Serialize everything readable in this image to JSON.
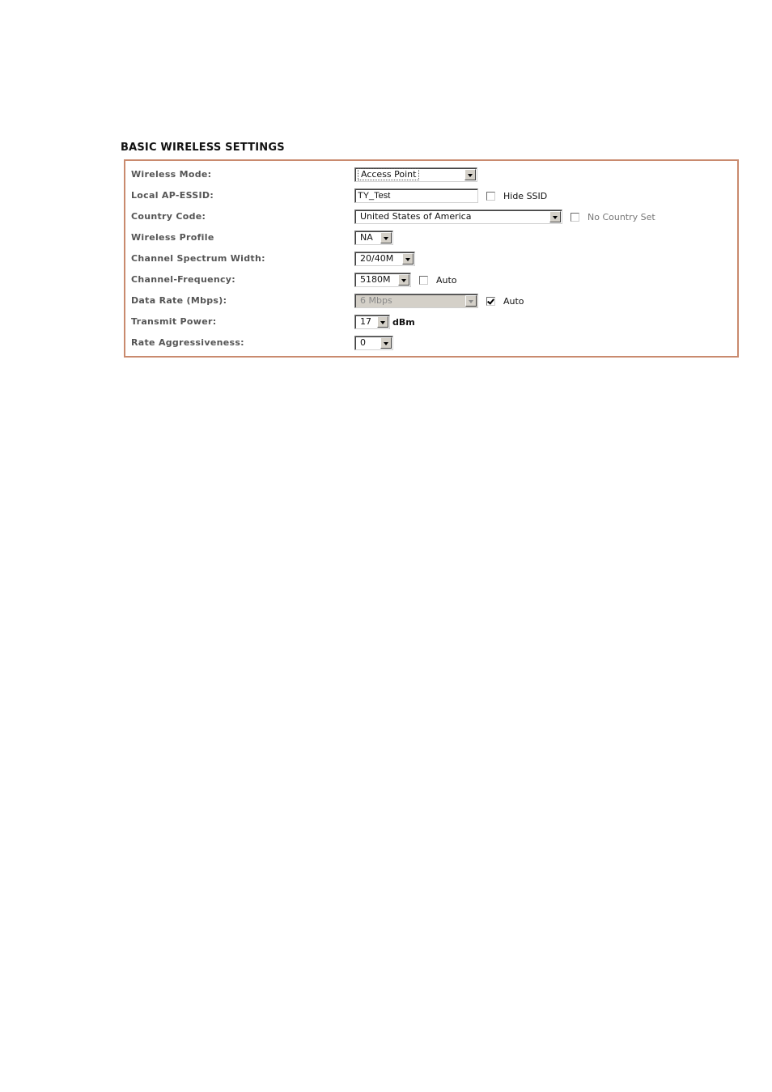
{
  "section": {
    "title": "BASIC WIRELESS SETTINGS"
  },
  "colors": {
    "panel_border": "#c98a6e",
    "label": "#555555"
  },
  "fields": {
    "wireless_mode": {
      "label": "Wireless Mode:",
      "value": "Access Point"
    },
    "essid": {
      "label": "Local AP-ESSID:",
      "value": "TY_Test",
      "hide_ssid_label": "Hide SSID",
      "hide_ssid_checked": false
    },
    "country_code": {
      "label": "Country Code:",
      "value": "United States of America",
      "no_country_label": "No Country Set",
      "no_country_checked": false
    },
    "wireless_profile": {
      "label": "Wireless Profile",
      "value": "NA"
    },
    "channel_width": {
      "label": "Channel Spectrum Width:",
      "value": "20/40M"
    },
    "channel_frequency": {
      "label": "Channel-Frequency:",
      "value": "5180M",
      "auto_label": "Auto",
      "auto_checked": false
    },
    "data_rate": {
      "label": "Data Rate (Mbps):",
      "value": "6 Mbps",
      "disabled": true,
      "auto_label": "Auto",
      "auto_checked": true
    },
    "transmit_power": {
      "label": "Transmit Power:",
      "value": "17",
      "unit": "dBm"
    },
    "rate_aggressiveness": {
      "label": "Rate Aggressiveness:",
      "value": "0"
    }
  }
}
